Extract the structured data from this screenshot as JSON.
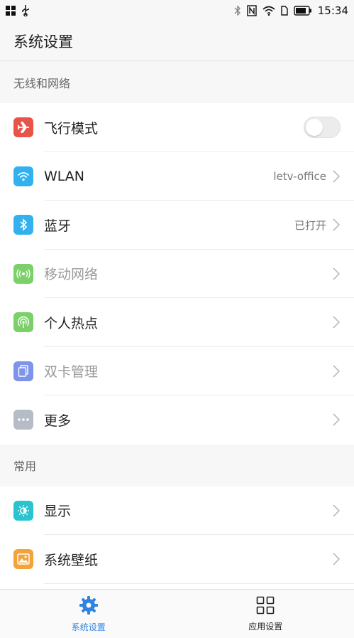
{
  "status_bar": {
    "time": "15:34",
    "left_icons": [
      "app-grid-icon",
      "usb-icon"
    ],
    "right_icons": [
      "bluetooth-icon",
      "nfc-icon",
      "wifi-icon",
      "sim-icon",
      "battery-icon"
    ]
  },
  "header": {
    "title": "系统设置"
  },
  "sections": [
    {
      "title": "无线和网络",
      "items": [
        {
          "label": "飞行模式",
          "icon": "airplane-icon",
          "icon_color": "#e8534a",
          "control": "toggle",
          "toggle_on": false,
          "dim": false
        },
        {
          "label": "WLAN",
          "icon": "wifi-icon",
          "icon_color": "#33b1ef",
          "value": "letv-office",
          "dim": false
        },
        {
          "label": "蓝牙",
          "icon": "bluetooth-icon",
          "icon_color": "#33b1ef",
          "value": "已打开",
          "dim": false
        },
        {
          "label": "移动网络",
          "icon": "cellular-icon",
          "icon_color": "#7bd06a",
          "dim": true
        },
        {
          "label": "个人热点",
          "icon": "hotspot-icon",
          "icon_color": "#7bd06a",
          "dim": false
        },
        {
          "label": "双卡管理",
          "icon": "dual-sim-icon",
          "icon_color": "#7d94ea",
          "dim": true
        },
        {
          "label": "更多",
          "icon": "more-icon",
          "icon_color": "#b5bcc5",
          "dim": false
        }
      ]
    },
    {
      "title": "常用",
      "items": [
        {
          "label": "显示",
          "icon": "display-icon",
          "icon_color": "#29c4cf",
          "dim": false
        },
        {
          "label": "系统壁纸",
          "icon": "wallpaper-icon",
          "icon_color": "#f4a33a",
          "dim": false
        }
      ]
    }
  ],
  "bottom_tabs": [
    {
      "label": "系统设置",
      "icon": "gear-icon",
      "active": true
    },
    {
      "label": "应用设置",
      "icon": "app-grid-icon",
      "active": false
    }
  ],
  "colors": {
    "accent": "#2f84e0"
  }
}
